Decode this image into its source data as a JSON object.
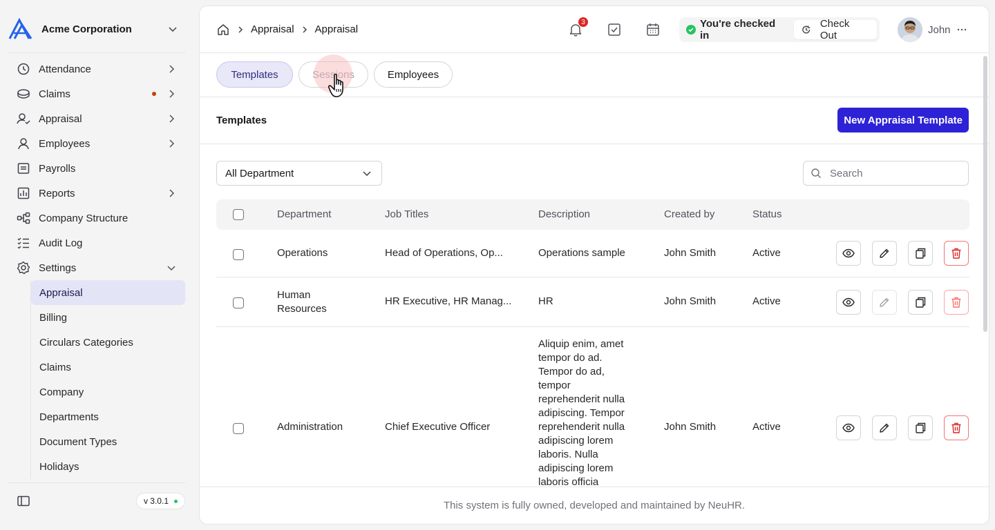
{
  "company": {
    "name": "Acme Corporation"
  },
  "sidebar": {
    "items": [
      {
        "label": "Attendance",
        "icon": "clock-icon",
        "has_arrow": true
      },
      {
        "label": "Claims",
        "icon": "coins-icon",
        "has_arrow": true,
        "dot": true
      },
      {
        "label": "Appraisal",
        "icon": "user-check-icon",
        "has_arrow": true
      },
      {
        "label": "Employees",
        "icon": "user-icon",
        "has_arrow": true
      },
      {
        "label": "Payrolls",
        "icon": "receipt-icon",
        "has_arrow": false
      },
      {
        "label": "Reports",
        "icon": "chart-icon",
        "has_arrow": true
      },
      {
        "label": "Company Structure",
        "icon": "hierarchy-icon",
        "has_arrow": false
      },
      {
        "label": "Audit Log",
        "icon": "list-check-icon",
        "has_arrow": false
      },
      {
        "label": "Settings",
        "icon": "gear-icon",
        "expanded": true
      }
    ],
    "settings_children": [
      "Appraisal",
      "Billing",
      "Circulars Categories",
      "Claims",
      "Company",
      "Departments",
      "Document Types",
      "Holidays"
    ],
    "active_child": "Appraisal",
    "version": "v 3.0.1"
  },
  "header": {
    "breadcrumb": [
      "Appraisal",
      "Appraisal"
    ],
    "notification_count": "3",
    "check_status": "You're checked in",
    "checkout_label": "Check Out",
    "user_name": "John"
  },
  "tabs": [
    "Templates",
    "Sessions",
    "Employees"
  ],
  "section": {
    "title": "Templates",
    "new_button": "New Appraisal Template"
  },
  "filters": {
    "department": "All Department",
    "search_placeholder": "Search"
  },
  "table": {
    "columns": [
      "Department",
      "Job Titles",
      "Description",
      "Created by",
      "Status"
    ],
    "rows": [
      {
        "department": "Operations",
        "job_titles": "Head of Operations, Op...",
        "description": "Operations sample",
        "created_by": "John Smith",
        "status": "Active",
        "edit_enabled": true,
        "delete_enabled": true
      },
      {
        "department": "Human Resources",
        "job_titles": "HR Executive, HR Manag...",
        "description": "HR",
        "created_by": "John Smith",
        "status": "Active",
        "edit_enabled": false,
        "delete_enabled": false
      },
      {
        "department": "Administration",
        "job_titles": "Chief Executive Officer",
        "description": "Aliquip enim, amet tempor do ad. Tempor do ad, tempor reprehenderit nulla adipiscing. Tempor reprehenderit nulla adipiscing lorem laboris. Nulla adipiscing lorem laboris officia",
        "created_by": "John Smith",
        "status": "Active",
        "edit_enabled": true,
        "delete_enabled": true
      }
    ]
  },
  "footer": {
    "text": "This system is fully owned, developed and maintained by NeuHR."
  },
  "colors": {
    "primary": "#2e22d6",
    "danger": "#dc2626",
    "success": "#22c55e",
    "active_tab_bg": "#e8e8f8"
  }
}
